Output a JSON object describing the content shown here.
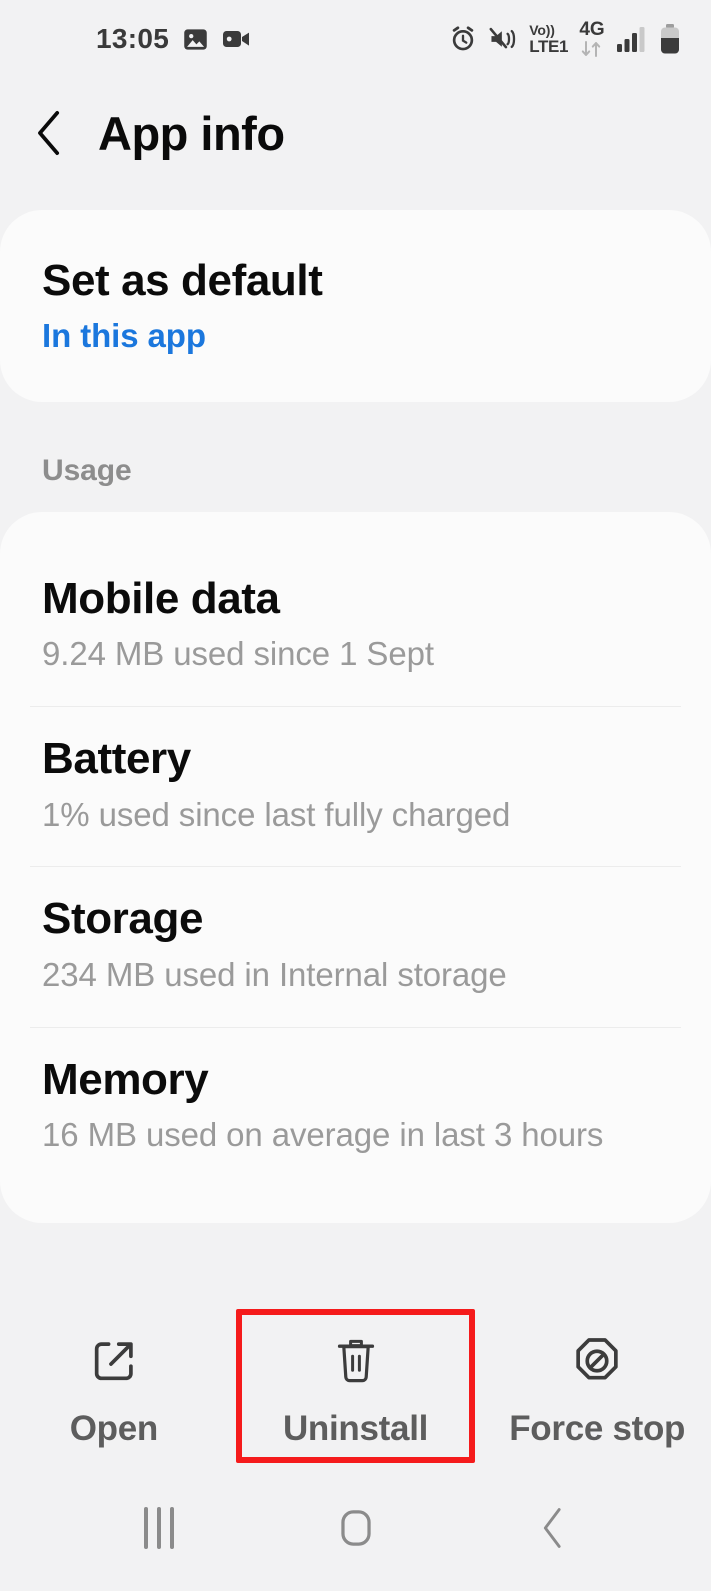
{
  "status_bar": {
    "time": "13:05",
    "left_icons": [
      "photo-icon",
      "screen-record-icon"
    ],
    "right_icons": [
      "alarm-icon",
      "mute-vibrate-icon",
      "volte-icon",
      "mobile-data-icon",
      "signal-icon",
      "battery-icon"
    ],
    "volte_line1": "Vo))",
    "volte_line2": "LTE1",
    "network_type": "4G"
  },
  "header": {
    "back_icon": "chevron-left-icon",
    "title": "App info"
  },
  "default_card": {
    "title": "Set as default",
    "subtitle": "In this app"
  },
  "usage_section": {
    "label": "Usage",
    "items": [
      {
        "title": "Mobile data",
        "subtitle": "9.24 MB used since 1 Sept"
      },
      {
        "title": "Battery",
        "subtitle": "1% used since last fully charged"
      },
      {
        "title": "Storage",
        "subtitle": "234 MB used in Internal storage"
      },
      {
        "title": "Memory",
        "subtitle": "16 MB used on average in last 3 hours"
      }
    ]
  },
  "action_bar": {
    "actions": [
      {
        "label": "Open",
        "icon": "open-external-icon",
        "highlighted": false
      },
      {
        "label": "Uninstall",
        "icon": "trash-icon",
        "highlighted": true
      },
      {
        "label": "Force stop",
        "icon": "block-octagon-icon",
        "highlighted": false
      }
    ]
  },
  "nav_bar": {
    "recents_icon": "recents-icon",
    "home_icon": "home-icon",
    "back_icon": "back-icon"
  },
  "colors": {
    "page_background": "#f2f2f3",
    "card_background": "#fbfbfb",
    "accent_blue": "#1b77dd",
    "highlight_red": "#f51b1b",
    "primary_text": "#0b0b0b",
    "secondary_text": "#9a9a9a"
  }
}
